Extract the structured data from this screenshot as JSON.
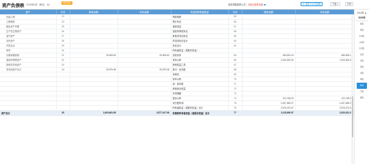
{
  "header": {
    "title": "资产负债表",
    "subtitle": "所属期：2019年6月（单位：元）",
    "tag": "财务报表",
    "notice_text": "如需调整报表公式，",
    "notice_link": "请前往报表设置",
    "buttons": [
      "自定义公式设置",
      "下载",
      "打印"
    ]
  },
  "columns": [
    "资产",
    "行次",
    "期末余额",
    "年初余额",
    "负债和所有者权益",
    "行次",
    "期末余额",
    "年初余额"
  ],
  "rows": [
    [
      "在建工程",
      "23",
      "",
      "",
      "预收账款",
      "55",
      "",
      ""
    ],
    [
      "工程物资",
      "24",
      "",
      "",
      "预计负债",
      "56",
      "",
      ""
    ],
    [
      "固定资产清理",
      "25",
      "",
      "",
      "递延收益",
      "57",
      "",
      ""
    ],
    [
      "生产性生物资产",
      "26",
      "",
      "",
      "递延所得税负债",
      "58",
      "",
      ""
    ],
    [
      "油气资产",
      "27",
      "",
      "",
      "其他非流动负债",
      "59",
      "",
      ""
    ],
    [
      "无形资产",
      "28",
      "",
      "",
      "非流动负债合计",
      "60",
      "",
      ""
    ],
    [
      "开发支出",
      "29",
      "",
      "",
      "负债合计",
      "61",
      "",
      ""
    ],
    [
      "商誉",
      "30",
      "",
      "",
      "所有者权益（或股东权益）：",
      "",
      "",
      ""
    ],
    [
      "长期待摊费用",
      "31",
      "29,005.63",
      "29,005.63",
      "实收资本",
      "65",
      "499,003.19",
      "580,818.17"
    ],
    [
      "递延所得税资产",
      "32",
      "",
      "",
      "资本公积",
      "66",
      "1,000,000.00",
      "1,000,000.00"
    ],
    [
      "其他非流动资产",
      "33",
      "",
      "",
      "其他权益工具",
      "67",
      "",
      ""
    ],
    [
      "非流动资产合计",
      "34",
      "33,979.08",
      "33,979.08",
      "其中：优先股",
      "68",
      "",
      ""
    ],
    [
      "",
      "",
      "",
      "",
      "永续债",
      "69",
      "",
      ""
    ],
    [
      "",
      "",
      "",
      "",
      "资本公积",
      "70",
      "",
      ""
    ],
    [
      "",
      "",
      "",
      "",
      "减：库存股",
      "71",
      "",
      ""
    ],
    [
      "",
      "",
      "",
      "",
      "其他综合收益",
      "72",
      "",
      ""
    ],
    [
      "",
      "",
      "",
      "",
      "专项储备",
      "73",
      "",
      ""
    ],
    [
      "",
      "",
      "",
      "",
      "盈余公积",
      "74",
      "121,748.20",
      "121,748.20"
    ],
    [
      "",
      "",
      "",
      "",
      "未分配利润",
      "75",
      "1,497,465.27",
      "1,497,465.27"
    ],
    [
      "",
      "",
      "",
      "",
      "所有者权益（或股东权益）合计",
      "76",
      "2,976,373.47",
      "2,976,373.47"
    ]
  ],
  "total": [
    "资产总计",
    "35",
    "2,409,661.85",
    "2,577,417.98",
    "负债和所有者权益（或股东权益）总计",
    "77",
    "3,115,906.57",
    "3,200,031.38"
  ],
  "period_panel": {
    "header": "2019年 ▲",
    "year": "2020年",
    "months": [
      "6月",
      "9月",
      "10月",
      "11月",
      "12月",
      "1月",
      "2月",
      "3月",
      "4月",
      "5月",
      "6月",
      "7月",
      "8月"
    ],
    "active_index": 10
  }
}
